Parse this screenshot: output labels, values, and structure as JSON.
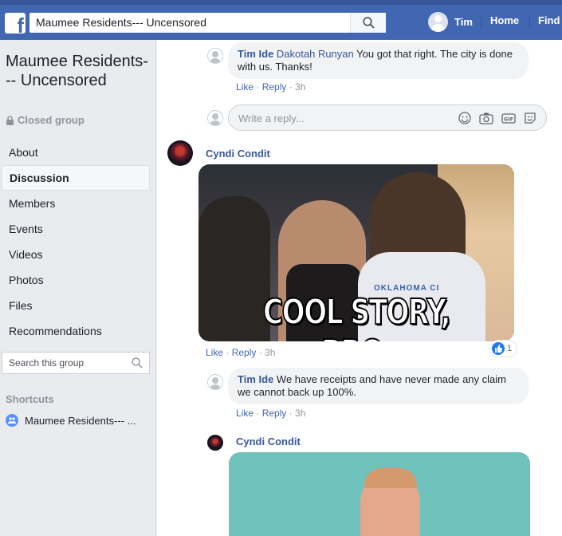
{
  "topbar": {
    "logo": "f",
    "search_value": "Maumee Residents--- Uncensored",
    "user_name": "Tim",
    "home": "Home",
    "find": "Find"
  },
  "sidebar": {
    "group_name": "Maumee Residents--- Uncensored",
    "privacy": "Closed group",
    "nav": [
      "About",
      "Discussion",
      "Members",
      "Events",
      "Videos",
      "Photos",
      "Files",
      "Recommendations"
    ],
    "active_nav": "Discussion",
    "search_placeholder": "Search this group",
    "shortcuts_heading": "Shortcuts",
    "shortcut_item": "Maumee Residents--- ..."
  },
  "feed": {
    "comment1": {
      "author": "Tim Ide",
      "tag": "Dakotah Runyan",
      "text": "You got that right. The city is done with us. Thanks!",
      "like": "Like",
      "reply": "Reply",
      "time": "3h"
    },
    "reply_placeholder": "Write a reply...",
    "post1": {
      "author": "Cyndi Condit",
      "gif_caption": "COOL STORY, BRO.",
      "gif_jersey": "OKLAHOMA CI",
      "like": "Like",
      "reply": "Reply",
      "time": "3h",
      "like_count": "1"
    },
    "comment2": {
      "author": "Tim Ide",
      "text": "We have receipts and have never made any claim we cannot back up 100%.",
      "like": "Like",
      "reply": "Reply",
      "time": "3h"
    },
    "post2": {
      "author": "Cyndi Condit"
    }
  },
  "colors": {
    "brand_blue": "#4267b2",
    "link_blue": "#385898",
    "bubble_gray": "#f2f3f5",
    "page_bg": "#e9ebee"
  },
  "icons": [
    "facebook-logo-icon",
    "search-icon",
    "lock-icon",
    "group-icon",
    "emoji-icon",
    "camera-icon",
    "gif-icon",
    "sticker-icon",
    "like-icon"
  ]
}
